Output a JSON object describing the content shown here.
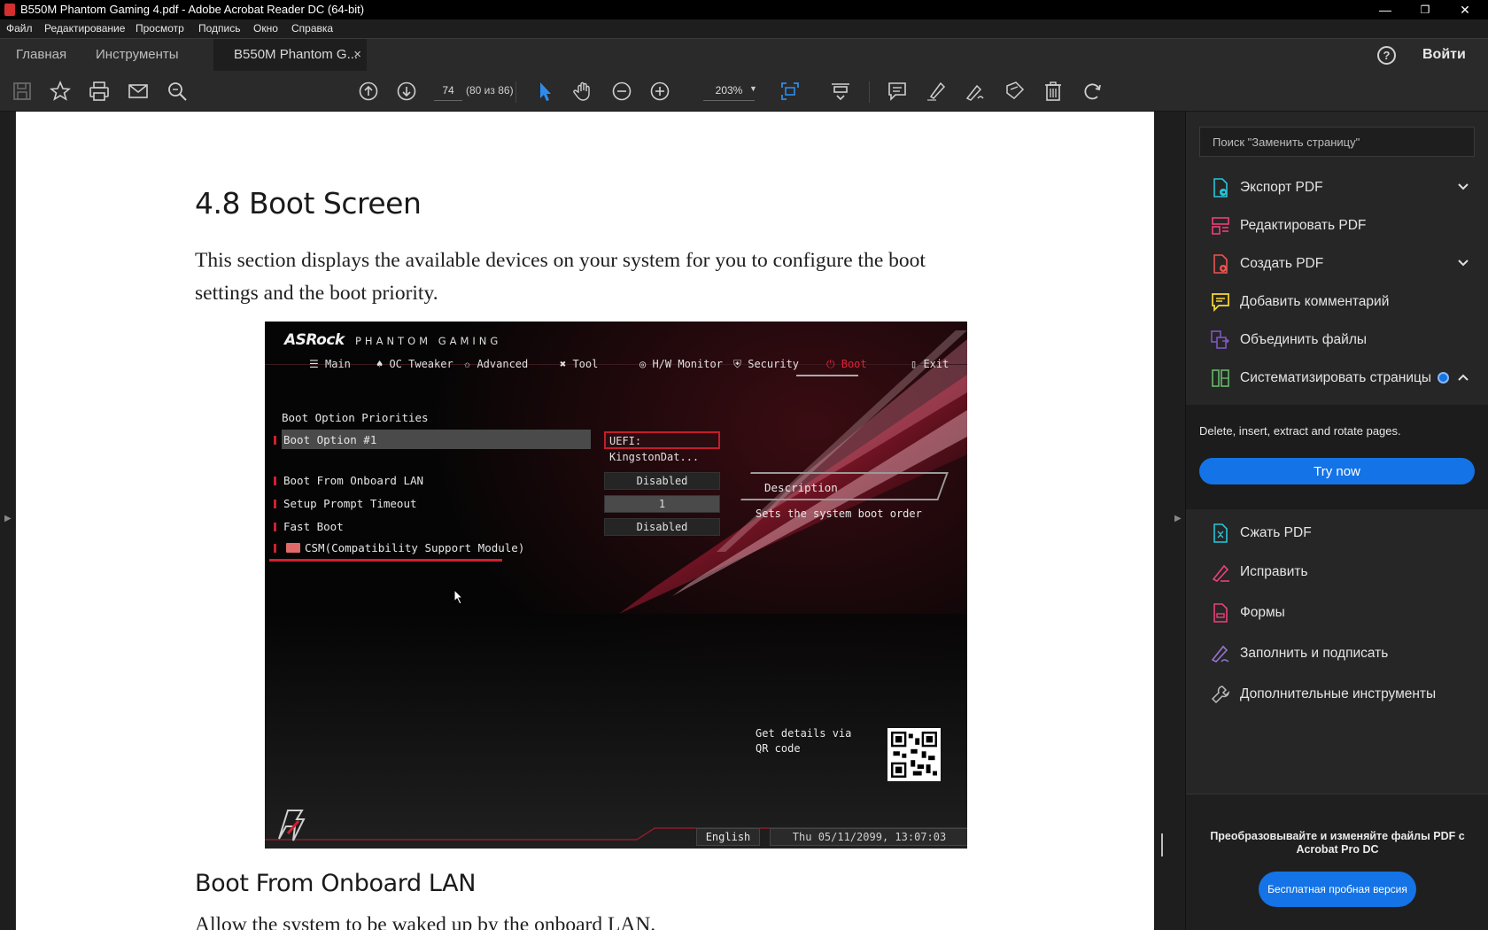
{
  "window": {
    "title": "B550M Phantom Gaming 4.pdf - Adobe Acrobat Reader DC (64-bit)",
    "minimize": "—",
    "maximize": "❐",
    "close": "✕"
  },
  "menu": [
    "Файл",
    "Редактирование",
    "Просмотр",
    "Подпись",
    "Окно",
    "Справка"
  ],
  "tabs": {
    "home": "Главная",
    "tools": "Инструменты",
    "document": "B550M Phantom G...",
    "close": "×"
  },
  "header": {
    "help": "?",
    "signin": "Войти"
  },
  "toolbar": {
    "page_number": "74",
    "page_count": "(80 из 86)",
    "zoom": "203%"
  },
  "document": {
    "heading": "4.8  Boot Screen",
    "intro": "This section displays the available devices on your system for you to configure the boot settings and the boot priority.",
    "subheading": "Boot From Onboard LAN",
    "cut_text": "Allow the system to be waked up by the onboard LAN."
  },
  "bios": {
    "brand": "ASRock",
    "brand_sub": "PHANTOM GAMING",
    "nav": [
      "☰ Main",
      "♠ OC Tweaker",
      "✩ Advanced",
      "✖ Tool",
      "◎ H/W Monitor",
      "⛨ Security",
      "⏻ Boot",
      "▯ Exit"
    ],
    "section_title": "Boot Option Priorities",
    "rows": [
      {
        "label": "Boot Option #1",
        "value": "UEFI: KingstonDat..."
      },
      {
        "label": "Boot From Onboard LAN",
        "value": "Disabled"
      },
      {
        "label": "Setup Prompt Timeout",
        "value": "1"
      },
      {
        "label": "Fast Boot",
        "value": "Disabled"
      }
    ],
    "csm": "CSM(Compatibility Support Module)",
    "description_title": "Description",
    "description_text": "Sets the system boot order",
    "qr_text": "Get details via QR code",
    "language": "English",
    "datetime": "Thu 05/11/2099, 13:07:03"
  },
  "right_panel": {
    "search_placeholder": "Поиск \"Заменить страницу\"",
    "items": [
      {
        "label": "Экспорт PDF",
        "color": "#26c6da"
      },
      {
        "label": "Редактировать PDF",
        "color": "#ec407a"
      },
      {
        "label": "Создать PDF",
        "color": "#ef5350"
      },
      {
        "label": "Добавить комментарий",
        "color": "#fdd835"
      },
      {
        "label": "Объединить файлы",
        "color": "#7e57c2"
      },
      {
        "label": "Систематизировать страницы",
        "color": "#66bb6a"
      }
    ],
    "expanded_desc": "Delete, insert, extract and rotate pages.",
    "try_now": "Try now",
    "more_items": [
      {
        "label": "Сжать PDF",
        "color": "#26c6da"
      },
      {
        "label": "Исправить",
        "color": "#ec407a"
      },
      {
        "label": "Формы",
        "color": "#ec407a"
      },
      {
        "label": "Заполнить и подписать",
        "color": "#9575cd"
      },
      {
        "label": "Дополнительные инструменты",
        "color": "#bdbdbd"
      }
    ],
    "promo": "Преобразовывайте и изменяйте файлы PDF с Acrobat Pro DC",
    "trial": "Бесплатная пробная версия"
  }
}
